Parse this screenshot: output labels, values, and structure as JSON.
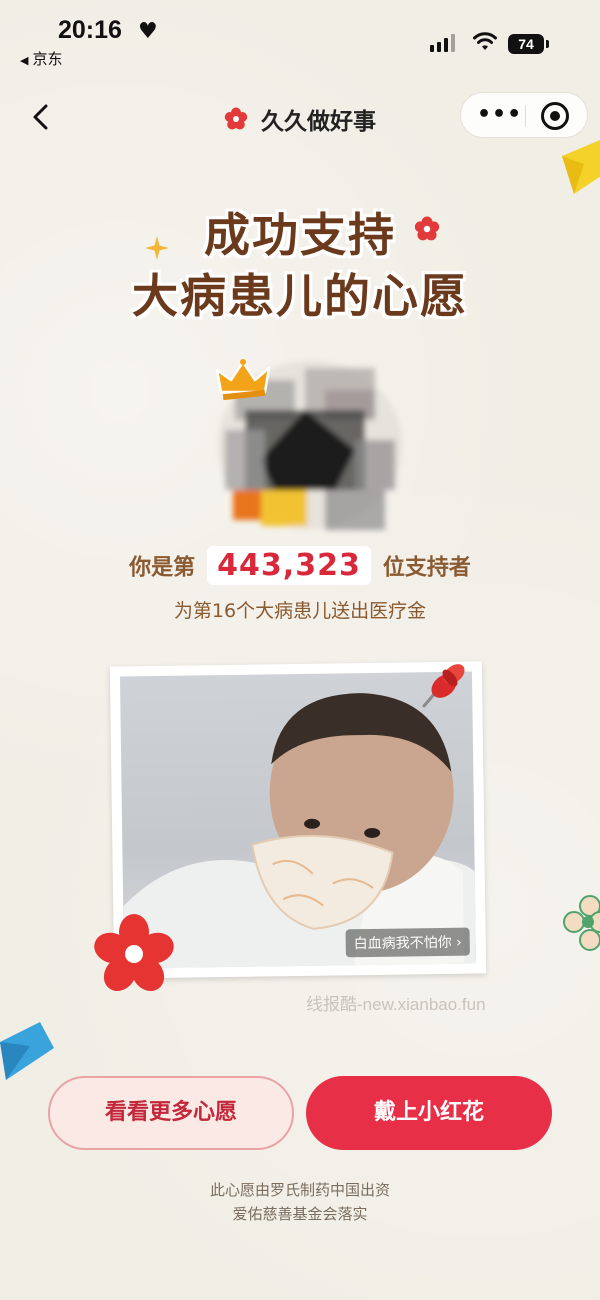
{
  "status_bar": {
    "time": "20:16",
    "back_app": "京东",
    "battery": "74"
  },
  "nav": {
    "title": "久久做好事"
  },
  "headline": {
    "line1": "成功支持",
    "line2": "大病患儿的心愿"
  },
  "supporter": {
    "prefix": "你是第",
    "count": "443,323",
    "suffix": "位支持者",
    "sub": "为第16个大病患儿送出医疗金"
  },
  "photo": {
    "caption": "白血病我不怕你 ›"
  },
  "watermark": "线报酷-new.xianbao.fun",
  "buttons": {
    "more": "看看更多心愿",
    "flower": "戴上小红花"
  },
  "footer": {
    "line1": "此心愿由罗氏制药中国出资",
    "line2": "爱佑慈善基金会落实"
  },
  "colors": {
    "accent": "#e73047",
    "brown": "#6b3a1d",
    "background": "#f1eee6"
  }
}
